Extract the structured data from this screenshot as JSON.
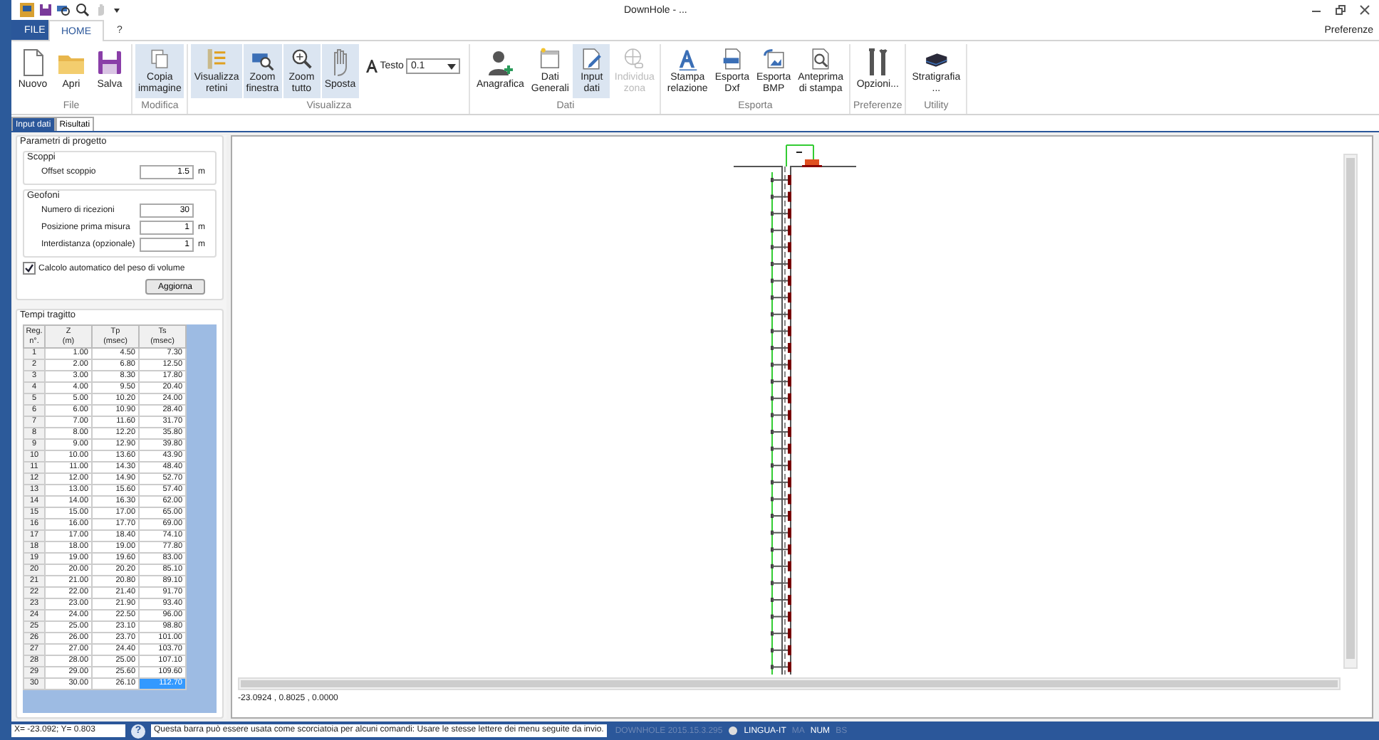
{
  "window": {
    "title": "DownHole - ..."
  },
  "ribbon_tabs": [
    {
      "label": "FILE",
      "kind": "file",
      "selected": false
    },
    {
      "label": "HOME",
      "kind": "tab",
      "selected": true
    },
    {
      "label": "?",
      "kind": "tab",
      "selected": false
    }
  ],
  "preferences_link": "Preferenze",
  "ribbon_groups": [
    {
      "label": "File",
      "items": [
        {
          "kind": "button",
          "label": "Nuovo",
          "selected": false,
          "disabled": false
        },
        {
          "kind": "button",
          "label": "Apri",
          "selected": false,
          "disabled": false
        },
        {
          "kind": "button",
          "label": "Salva",
          "selected": false,
          "disabled": false
        }
      ]
    },
    {
      "label": "Modifica",
      "items": [
        {
          "kind": "button",
          "label": "Copia\nimmagine",
          "selected": true,
          "disabled": false
        }
      ]
    },
    {
      "label": "Visualizza",
      "items": [
        {
          "kind": "button",
          "label": "Visualizza\nretini",
          "selected": true,
          "disabled": false
        },
        {
          "kind": "button",
          "label": "Zoom\nfinestra",
          "selected": true,
          "disabled": false
        },
        {
          "kind": "button",
          "label": "Zoom\ntutto",
          "selected": true,
          "disabled": false
        },
        {
          "kind": "button",
          "label": "Sposta",
          "selected": true,
          "disabled": false
        },
        {
          "kind": "combo",
          "label": "Testo",
          "value": "0.1"
        }
      ]
    },
    {
      "label": "Dati",
      "items": [
        {
          "kind": "button",
          "label": "Anagrafica",
          "selected": false,
          "disabled": false
        },
        {
          "kind": "button",
          "label": "Dati\nGenerali",
          "selected": false,
          "disabled": false
        },
        {
          "kind": "button",
          "label": "Input\ndati",
          "selected": true,
          "disabled": false
        },
        {
          "kind": "button",
          "label": "Individua\nzona",
          "selected": false,
          "disabled": true
        }
      ]
    },
    {
      "label": "Esporta",
      "items": [
        {
          "kind": "button",
          "label": "Stampa\nrelazione",
          "selected": false,
          "disabled": false
        },
        {
          "kind": "button",
          "label": "Esporta\nDxf",
          "selected": false,
          "disabled": false
        },
        {
          "kind": "button",
          "label": "Esporta\nBMP",
          "selected": false,
          "disabled": false
        },
        {
          "kind": "button",
          "label": "Anteprima\ndi stampa",
          "selected": false,
          "disabled": false
        }
      ]
    },
    {
      "label": "Preferenze",
      "items": [
        {
          "kind": "button",
          "label": "Opzioni...",
          "selected": false,
          "disabled": false
        }
      ]
    },
    {
      "label": "Utility",
      "items": [
        {
          "kind": "button",
          "label": "Stratigrafia\n...",
          "selected": false,
          "disabled": false
        }
      ]
    }
  ],
  "doc_tabs": [
    {
      "label": "Input dati",
      "selected": true
    },
    {
      "label": "Risultati",
      "selected": false
    }
  ],
  "parameters": {
    "title": "Parametri di progetto",
    "sections": [
      {
        "title": "Scoppi",
        "fields": [
          {
            "label": "Offset scoppio",
            "value": "1.5",
            "unit": "m"
          }
        ]
      },
      {
        "title": "Geofoni",
        "fields": [
          {
            "label": "Numero di ricezioni",
            "value": "30"
          },
          {
            "label": "Posizione prima misura",
            "value": "1",
            "unit": "m"
          },
          {
            "label": "Interdistanza (opzionale)",
            "value": "1",
            "unit": "m"
          }
        ]
      }
    ],
    "auto_volume_weight": {
      "label": "Calcolo automatico del peso di volume",
      "checked": true
    },
    "update_button": "Aggiorna"
  },
  "travel_times": {
    "title": "Tempi tragitto",
    "columns": [
      "Reg.\nn°.",
      "Z\n(m)",
      "Tp\n(msec)",
      "Ts\n(msec)"
    ],
    "rows": [
      {
        "cells": [
          "1",
          "1.00",
          "4.50",
          "7.30"
        ],
        "selected": false
      },
      {
        "cells": [
          "2",
          "2.00",
          "6.80",
          "12.50"
        ],
        "selected": false
      },
      {
        "cells": [
          "3",
          "3.00",
          "8.30",
          "17.80"
        ],
        "selected": false
      },
      {
        "cells": [
          "4",
          "4.00",
          "9.50",
          "20.40"
        ],
        "selected": false
      },
      {
        "cells": [
          "5",
          "5.00",
          "10.20",
          "24.00"
        ],
        "selected": false
      },
      {
        "cells": [
          "6",
          "6.00",
          "10.90",
          "28.40"
        ],
        "selected": false
      },
      {
        "cells": [
          "7",
          "7.00",
          "11.60",
          "31.70"
        ],
        "selected": false
      },
      {
        "cells": [
          "8",
          "8.00",
          "12.20",
          "35.80"
        ],
        "selected": false
      },
      {
        "cells": [
          "9",
          "9.00",
          "12.90",
          "39.80"
        ],
        "selected": false
      },
      {
        "cells": [
          "10",
          "10.00",
          "13.60",
          "43.90"
        ],
        "selected": false
      },
      {
        "cells": [
          "11",
          "11.00",
          "14.30",
          "48.40"
        ],
        "selected": false
      },
      {
        "cells": [
          "12",
          "12.00",
          "14.90",
          "52.70"
        ],
        "selected": false
      },
      {
        "cells": [
          "13",
          "13.00",
          "15.60",
          "57.40"
        ],
        "selected": false
      },
      {
        "cells": [
          "14",
          "14.00",
          "16.30",
          "62.00"
        ],
        "selected": false
      },
      {
        "cells": [
          "15",
          "15.00",
          "17.00",
          "65.00"
        ],
        "selected": false
      },
      {
        "cells": [
          "16",
          "16.00",
          "17.70",
          "69.00"
        ],
        "selected": false
      },
      {
        "cells": [
          "17",
          "17.00",
          "18.40",
          "74.10"
        ],
        "selected": false
      },
      {
        "cells": [
          "18",
          "18.00",
          "19.00",
          "77.80"
        ],
        "selected": false
      },
      {
        "cells": [
          "19",
          "19.00",
          "19.60",
          "83.00"
        ],
        "selected": false
      },
      {
        "cells": [
          "20",
          "20.00",
          "20.20",
          "85.10"
        ],
        "selected": false
      },
      {
        "cells": [
          "21",
          "21.00",
          "20.80",
          "89.10"
        ],
        "selected": false
      },
      {
        "cells": [
          "22",
          "22.00",
          "21.40",
          "91.70"
        ],
        "selected": false
      },
      {
        "cells": [
          "23",
          "23.00",
          "21.90",
          "93.40"
        ],
        "selected": false
      },
      {
        "cells": [
          "24",
          "24.00",
          "22.50",
          "96.00"
        ],
        "selected": false
      },
      {
        "cells": [
          "25",
          "25.00",
          "23.10",
          "98.80"
        ],
        "selected": false
      },
      {
        "cells": [
          "26",
          "26.00",
          "23.70",
          "101.00"
        ],
        "selected": false
      },
      {
        "cells": [
          "27",
          "27.00",
          "24.40",
          "103.70"
        ],
        "selected": false
      },
      {
        "cells": [
          "28",
          "28.00",
          "25.00",
          "107.10"
        ],
        "selected": false
      },
      {
        "cells": [
          "29",
          "29.00",
          "25.60",
          "109.60"
        ],
        "selected": false
      },
      {
        "cells": [
          "30",
          "30.00",
          "26.10",
          "112.70"
        ],
        "selected": true
      }
    ]
  },
  "canvas": {
    "coordinates": "-23.0924 , 0.8025 , 0.0000"
  },
  "status_bar": {
    "cursor": "X= -23.092; Y= 0.803",
    "help": "?",
    "message": "Questa barra può essere usata come scorciatoia per alcuni comandi: Usare le stesse lettere dei menu seguite da invio.",
    "indicators": [
      {
        "label": "DOWNHOLE 2015.15.3.295",
        "on": false
      },
      {
        "label": "LINGUA-IT",
        "on": true,
        "kind": "language"
      },
      {
        "label": "MA",
        "on": false
      },
      {
        "label": "NUM",
        "on": true
      },
      {
        "label": "BS",
        "on": false
      }
    ]
  }
}
